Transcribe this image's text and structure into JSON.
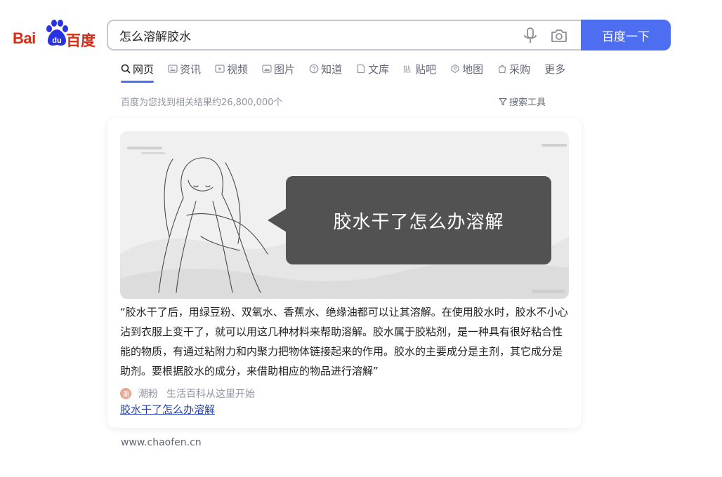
{
  "logo": {
    "text_left": "Bai",
    "paw_text": "du",
    "text_right": "百度"
  },
  "search": {
    "query": "怎么溶解胶水",
    "button_label": "百度一下"
  },
  "tabs": [
    {
      "label": "网页"
    },
    {
      "label": "资讯"
    },
    {
      "label": "视频"
    },
    {
      "label": "图片"
    },
    {
      "label": "知道"
    },
    {
      "label": "文库"
    },
    {
      "label": "贴吧"
    },
    {
      "label": "地图"
    },
    {
      "label": "采购"
    },
    {
      "label": "更多"
    }
  ],
  "result_count": "百度为您找到相关结果约26,800,000个",
  "search_tools_label": "搜索工具",
  "result": {
    "image_caption": "胶水干了怎么办溶解",
    "summary": "“胶水干了后，用绿豆粉、双氧水、香蕉水、绝缘油都可以让其溶解。在使用胶水时，胶水不小心沾到衣服上变干了，就可以用这几种材料来帮助溶解。胶水属于胶粘剂，是一种具有很好粘合性能的物质，有通过粘附力和内聚力把物体链接起来的作用。胶水的主要成分是主剂，其它成分是助剂。要根据胶水的成分，来借助相应的物品进行溶解”",
    "source_avatar": "潮",
    "source_name": "潮粉",
    "source_tagline": "生活百科从这里开始",
    "link_title": "胶水干了怎么办溶解",
    "url": "www.chaofen.cn"
  },
  "colors": {
    "brand_red": "#de2910",
    "brand_blue": "#4e6ef2",
    "link": "#2440b3",
    "muted": "#9195a3"
  }
}
